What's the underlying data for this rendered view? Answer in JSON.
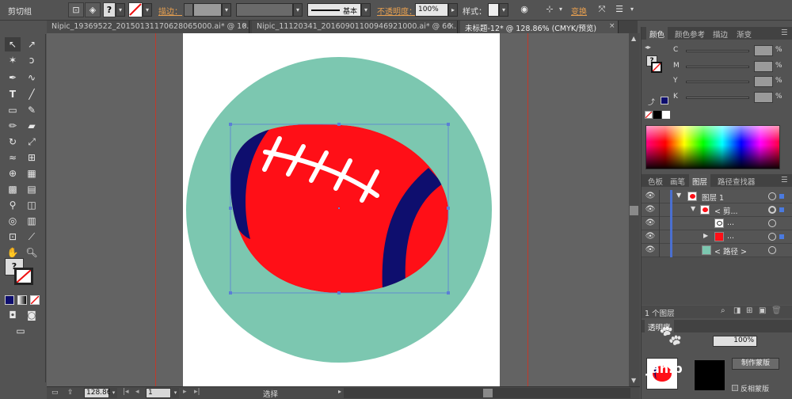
{
  "control_bar": {
    "selection_label": "剪切组",
    "stroke_label": "描边：",
    "stroke_style": "基本",
    "opacity_label": "不透明度：",
    "opacity_value": "100%",
    "style_label": "样式：",
    "transform_label": "变换",
    "help_glyph": "?"
  },
  "tabs": [
    {
      "label": "Nipic_19369522_20150131170628065000.ai* @ 10...",
      "active": false
    },
    {
      "label": "Nipic_11120341_20160901100946921000.ai* @ 66...",
      "active": false
    },
    {
      "label": "未标题-12* @ 128.86% (CMYK/预览)",
      "active": true
    }
  ],
  "tab_close": "×",
  "colors": {
    "bg_circle": "#7cc7b0",
    "ball_red": "#ff0f17",
    "ball_navy": "#0e0e6e",
    "lace_white": "#ffffff",
    "selection_blue": "#5b7fd6",
    "guide_red": "#c0392b",
    "orange_text": "#e8a050"
  },
  "color_panel": {
    "tabs": [
      "颜色",
      "颜色参考",
      "描边",
      "渐变"
    ],
    "channels": [
      "C",
      "M",
      "Y",
      "K"
    ],
    "unit": "%"
  },
  "layers_panel": {
    "tabs": [
      "色板",
      "画笔",
      "图层",
      "路径查找器"
    ],
    "rows": [
      {
        "name": "图层 1"
      },
      {
        "name": "< 剪..."
      },
      {
        "name": "..."
      },
      {
        "name": "..."
      },
      {
        "name": "< 路径 >"
      }
    ],
    "footer": "1 个图层"
  },
  "transparency_panel": {
    "title": "透明度",
    "opacity": "100%",
    "make_mask_button": "制作蒙版",
    "invert_mask_label": "反相蒙版",
    "watermark": "Jan.b"
  },
  "status_bar": {
    "zoom": "128.86",
    "page": "1",
    "mode": "选择"
  }
}
